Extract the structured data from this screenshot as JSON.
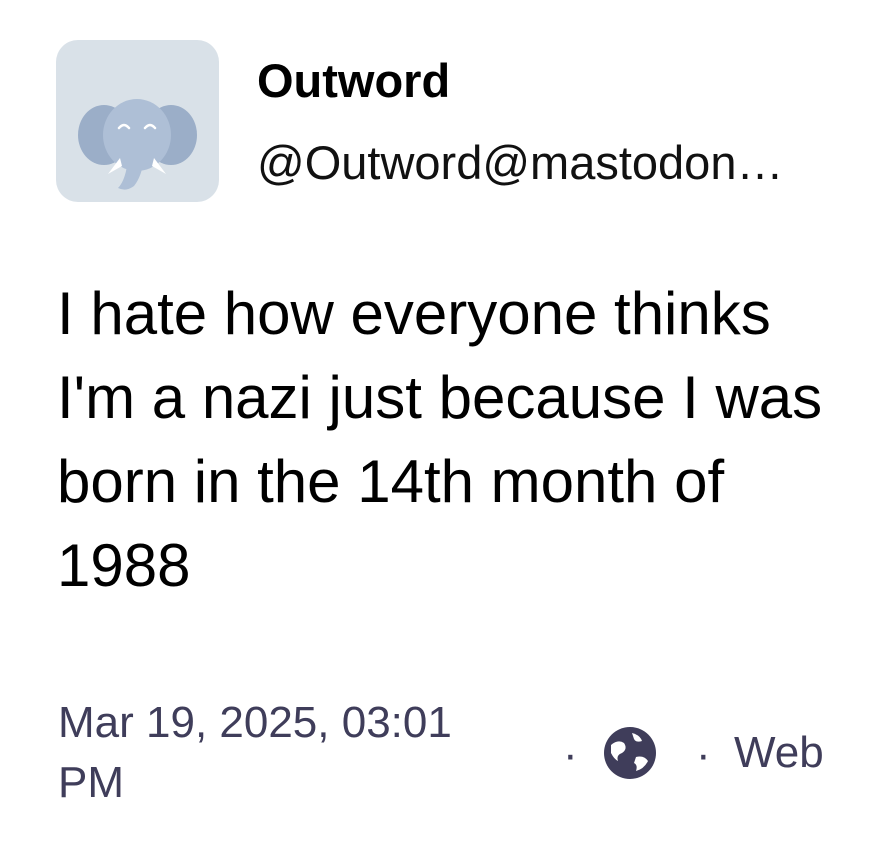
{
  "author": {
    "display_name": "Outword",
    "handle": "@Outword@mastodon…",
    "avatar_icon": "mastodon-elephant-icon"
  },
  "post": {
    "text": "I hate how everyone thinks I'm a nazi just because I was born in the 14th month of 1988"
  },
  "meta": {
    "timestamp": "Mar 19, 2025, 03:01 PM",
    "separator": "·",
    "visibility_icon": "globe-icon",
    "application": "Web"
  },
  "colors": {
    "avatar_bg": "#d9e1e8",
    "elephant": "#9baec8",
    "meta_text": "#3f3d5a"
  }
}
